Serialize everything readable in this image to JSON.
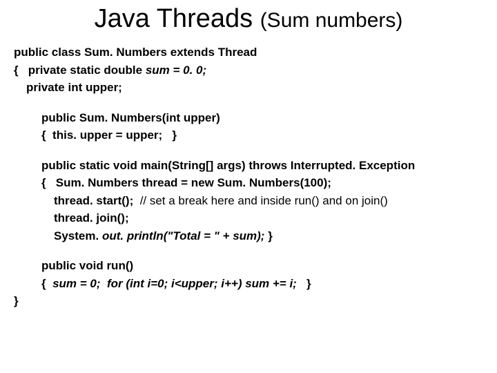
{
  "title_main": "Java Threads ",
  "title_sub": "(Sum numbers)",
  "lines": {
    "l1": "public class Sum. Numbers extends Thread",
    "l2_a": "{   private static double ",
    "l2_b": "sum = 0. 0;",
    "l3": "private int upper;",
    "l4": "public Sum. Numbers(int upper)",
    "l5": "{  this. upper = upper;   }",
    "l6": "public static void main(String[] args) throws Interrupted. Exception",
    "l7": "{   Sum. Numbers thread = new Sum. Numbers(100);",
    "l8_a": "thread. start();  ",
    "l8_b": "// set a break here and inside run() and on join()",
    "l9": "thread. join();",
    "l10_a": "System. ",
    "l10_b": "out. println(\"Total = \" + sum); ",
    "l10_c": "}",
    "l11": "public void run()",
    "l12_a": "{  ",
    "l12_b": "sum = 0;  for (int i=0; i<upper; i++) sum += i;   ",
    "l12_c": "}",
    "l13": "}"
  }
}
